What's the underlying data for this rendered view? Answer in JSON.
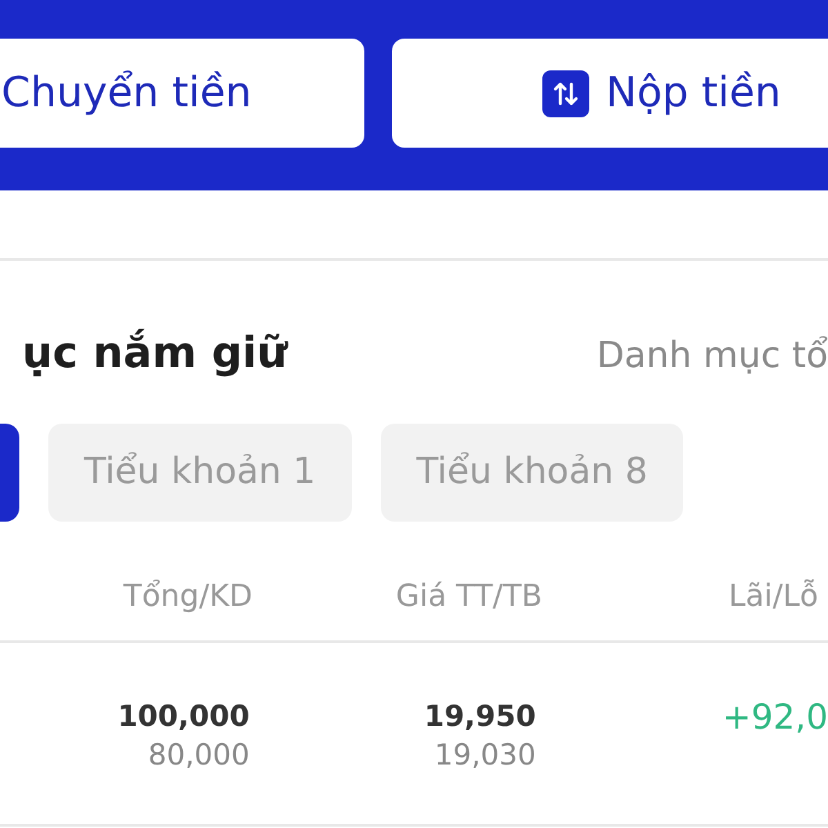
{
  "transfer_buttons": [
    {
      "label": "Chuyển tiền",
      "kind": "plain"
    },
    {
      "label": "Nộp tiền",
      "kind": "icon"
    }
  ],
  "portfolio": {
    "title": "ục nắm giữ",
    "link": "Danh mục tổ"
  },
  "account_tabs": [
    {
      "selected": true
    },
    {
      "label": "Tiểu khoản 1",
      "selected": false
    },
    {
      "label": "Tiểu khoản 8",
      "selected": false
    }
  ],
  "table": {
    "columns": [
      "Tổng/KD",
      "Giá TT/TB",
      "Lãi/Lỗ"
    ],
    "rows": [
      {
        "total": "100,000",
        "available": "80,000",
        "market_price": "19,950",
        "average_price": "19,030",
        "profit_loss": "+92,0",
        "gain": true
      }
    ]
  }
}
